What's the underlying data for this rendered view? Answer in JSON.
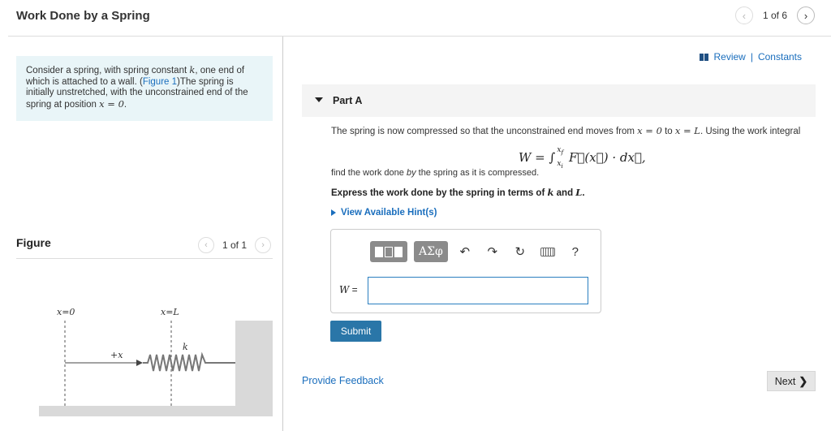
{
  "header": {
    "title": "Work Done by a Spring",
    "page_indicator": "1 of 6",
    "prev_icon": "‹",
    "next_icon": "›"
  },
  "intro": {
    "text_1": "Consider a spring, with spring constant ",
    "k": "k",
    "text_2": ", one end of which is attached to a wall. (",
    "figure_link": "Figure 1",
    "text_3": ")The spring is initially unstretched, with the unconstrained end of the spring at position ",
    "x_eq_0": "x = 0",
    "text_4": "."
  },
  "figure": {
    "title": "Figure",
    "pager": "1 of 1",
    "labels": {
      "x0": "x=0",
      "xL": "x=L",
      "plus_x": "+x",
      "k": "k"
    }
  },
  "links": {
    "review": "Review",
    "separator": "|",
    "constants": "Constants"
  },
  "part": {
    "label": "Part A",
    "question_1": "The spring is now compressed so that the unconstrained end moves from ",
    "from": "x = 0",
    "to_word": " to ",
    "to": "x = L",
    "question_2": ". Using the work integral",
    "formula_lhs": "W = ∫",
    "formula_upper": "x",
    "formula_upper_sub": "f",
    "formula_lower": "x",
    "formula_lower_sub": "i",
    "formula_rhs": " F⃗(x⃗) · dx⃗,",
    "question_3a": "find the work done ",
    "question_3b": "by",
    "question_3c": " the spring as it is compressed.",
    "instruction_1": "Express the work done by the spring in terms of ",
    "instruction_k": "k",
    "instruction_and": " and ",
    "instruction_L": "L",
    "instruction_end": ".",
    "hints": "View Available Hint(s)"
  },
  "answer": {
    "greek_button": "ΑΣφ",
    "undo_icon": "↶",
    "redo_icon": "↷",
    "reset_icon": "↻",
    "help": "?",
    "label": "W",
    "label_eq": " =",
    "value": ""
  },
  "actions": {
    "submit": "Submit",
    "feedback": "Provide Feedback",
    "next": "Next",
    "next_icon": "❯"
  }
}
